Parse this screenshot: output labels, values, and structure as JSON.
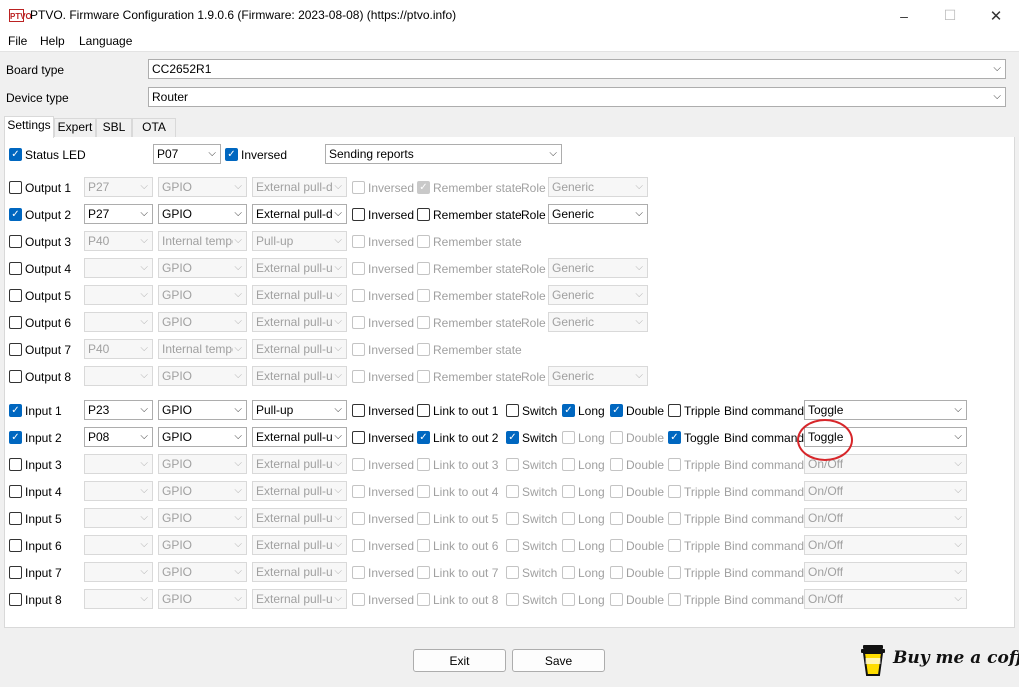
{
  "window": {
    "title": "PTVO. Firmware Configuration 1.9.0.6 (Firmware: 2023-08-08) (https://ptvo.info)",
    "icon_text": "PTVO",
    "minimize": "–",
    "maximize": "☐",
    "close": "✕"
  },
  "menu": [
    "File",
    "Help",
    "Language"
  ],
  "board_type": {
    "label": "Board type",
    "value": "CC2652R1"
  },
  "device_type": {
    "label": "Device type",
    "value": "Router"
  },
  "tabs": [
    "Settings",
    "Expert",
    "SBL",
    "OTA"
  ],
  "status_led": {
    "label": "Status LED",
    "checked": true,
    "pin": "P07",
    "inversed_label": "Inversed",
    "inversed": true,
    "mode": "Sending reports"
  },
  "outputs": [
    {
      "label": "Output 1",
      "checked": false,
      "pin": "P27",
      "type": "GPIO",
      "pull": "External pull-dc",
      "inversed": false,
      "remember": true,
      "role_label": "Role",
      "role": "Generic",
      "show_role": true
    },
    {
      "label": "Output 2",
      "checked": true,
      "pin": "P27",
      "type": "GPIO",
      "pull": "External pull-dc",
      "inversed": false,
      "remember": false,
      "role_label": "Role",
      "role": "Generic",
      "show_role": true
    },
    {
      "label": "Output 3",
      "checked": false,
      "pin": "P40",
      "type": "Internal tempe",
      "pull": "Pull-up",
      "inversed": false,
      "remember": false,
      "role_label": "",
      "role": "",
      "show_role": false
    },
    {
      "label": "Output 4",
      "checked": false,
      "pin": "",
      "type": "GPIO",
      "pull": "External pull-up",
      "inversed": false,
      "remember": false,
      "role_label": "Role",
      "role": "Generic",
      "show_role": true
    },
    {
      "label": "Output 5",
      "checked": false,
      "pin": "",
      "type": "GPIO",
      "pull": "External pull-up",
      "inversed": false,
      "remember": false,
      "role_label": "Role",
      "role": "Generic",
      "show_role": true
    },
    {
      "label": "Output 6",
      "checked": false,
      "pin": "",
      "type": "GPIO",
      "pull": "External pull-up",
      "inversed": false,
      "remember": false,
      "role_label": "Role",
      "role": "Generic",
      "show_role": true
    },
    {
      "label": "Output 7",
      "checked": false,
      "pin": "P40",
      "type": "Internal tempe",
      "pull": "External pull-up",
      "inversed": false,
      "remember": false,
      "role_label": "",
      "role": "",
      "show_role": false
    },
    {
      "label": "Output 8",
      "checked": false,
      "pin": "",
      "type": "GPIO",
      "pull": "External pull-up",
      "inversed": false,
      "remember": false,
      "role_label": "Role",
      "role": "Generic",
      "show_role": true
    }
  ],
  "output_labels": {
    "inversed": "Inversed",
    "remember": "Remember state"
  },
  "inputs": [
    {
      "label": "Input 1",
      "checked": true,
      "pin": "P23",
      "type": "GPIO",
      "pull": "Pull-up",
      "inversed": false,
      "link": "Link to out 1",
      "link_on": false,
      "switch": false,
      "long": true,
      "double": true,
      "third": "Tripple",
      "third_on": false,
      "bind": "Toggle"
    },
    {
      "label": "Input 2",
      "checked": true,
      "pin": "P08",
      "type": "GPIO",
      "pull": "External pull-up",
      "inversed": false,
      "link": "Link to out 2",
      "link_on": true,
      "switch": true,
      "long": false,
      "double": false,
      "third": "Toggle",
      "third_on": true,
      "bind": "Toggle"
    },
    {
      "label": "Input 3",
      "checked": false,
      "pin": "",
      "type": "GPIO",
      "pull": "External pull-up",
      "inversed": false,
      "link": "Link to out 3",
      "link_on": false,
      "switch": false,
      "long": false,
      "double": false,
      "third": "Tripple",
      "third_on": false,
      "bind": "On/Off"
    },
    {
      "label": "Input 4",
      "checked": false,
      "pin": "",
      "type": "GPIO",
      "pull": "External pull-up",
      "inversed": false,
      "link": "Link to out 4",
      "link_on": false,
      "switch": false,
      "long": false,
      "double": false,
      "third": "Tripple",
      "third_on": false,
      "bind": "On/Off"
    },
    {
      "label": "Input 5",
      "checked": false,
      "pin": "",
      "type": "GPIO",
      "pull": "External pull-up",
      "inversed": false,
      "link": "Link to out 5",
      "link_on": false,
      "switch": false,
      "long": false,
      "double": false,
      "third": "Tripple",
      "third_on": false,
      "bind": "On/Off"
    },
    {
      "label": "Input 6",
      "checked": false,
      "pin": "",
      "type": "GPIO",
      "pull": "External pull-up",
      "inversed": false,
      "link": "Link to out 6",
      "link_on": false,
      "switch": false,
      "long": false,
      "double": false,
      "third": "Tripple",
      "third_on": false,
      "bind": "On/Off"
    },
    {
      "label": "Input 7",
      "checked": false,
      "pin": "",
      "type": "GPIO",
      "pull": "External pull-up",
      "inversed": false,
      "link": "Link to out 7",
      "link_on": false,
      "switch": false,
      "long": false,
      "double": false,
      "third": "Tripple",
      "third_on": false,
      "bind": "On/Off"
    },
    {
      "label": "Input 8",
      "checked": false,
      "pin": "",
      "type": "GPIO",
      "pull": "External pull-up",
      "inversed": false,
      "link": "Link to out 8",
      "link_on": false,
      "switch": false,
      "long": false,
      "double": false,
      "third": "Tripple",
      "third_on": false,
      "bind": "On/Off"
    }
  ],
  "input_labels": {
    "inversed": "Inversed",
    "switch": "Switch",
    "long": "Long",
    "double": "Double",
    "bind": "Bind command"
  },
  "buttons": {
    "exit": "Exit",
    "save": "Save"
  },
  "coffee": "Buy me a coffee",
  "colors": {
    "accent": "#0067c0",
    "highlight_circle": "#d7262a"
  }
}
